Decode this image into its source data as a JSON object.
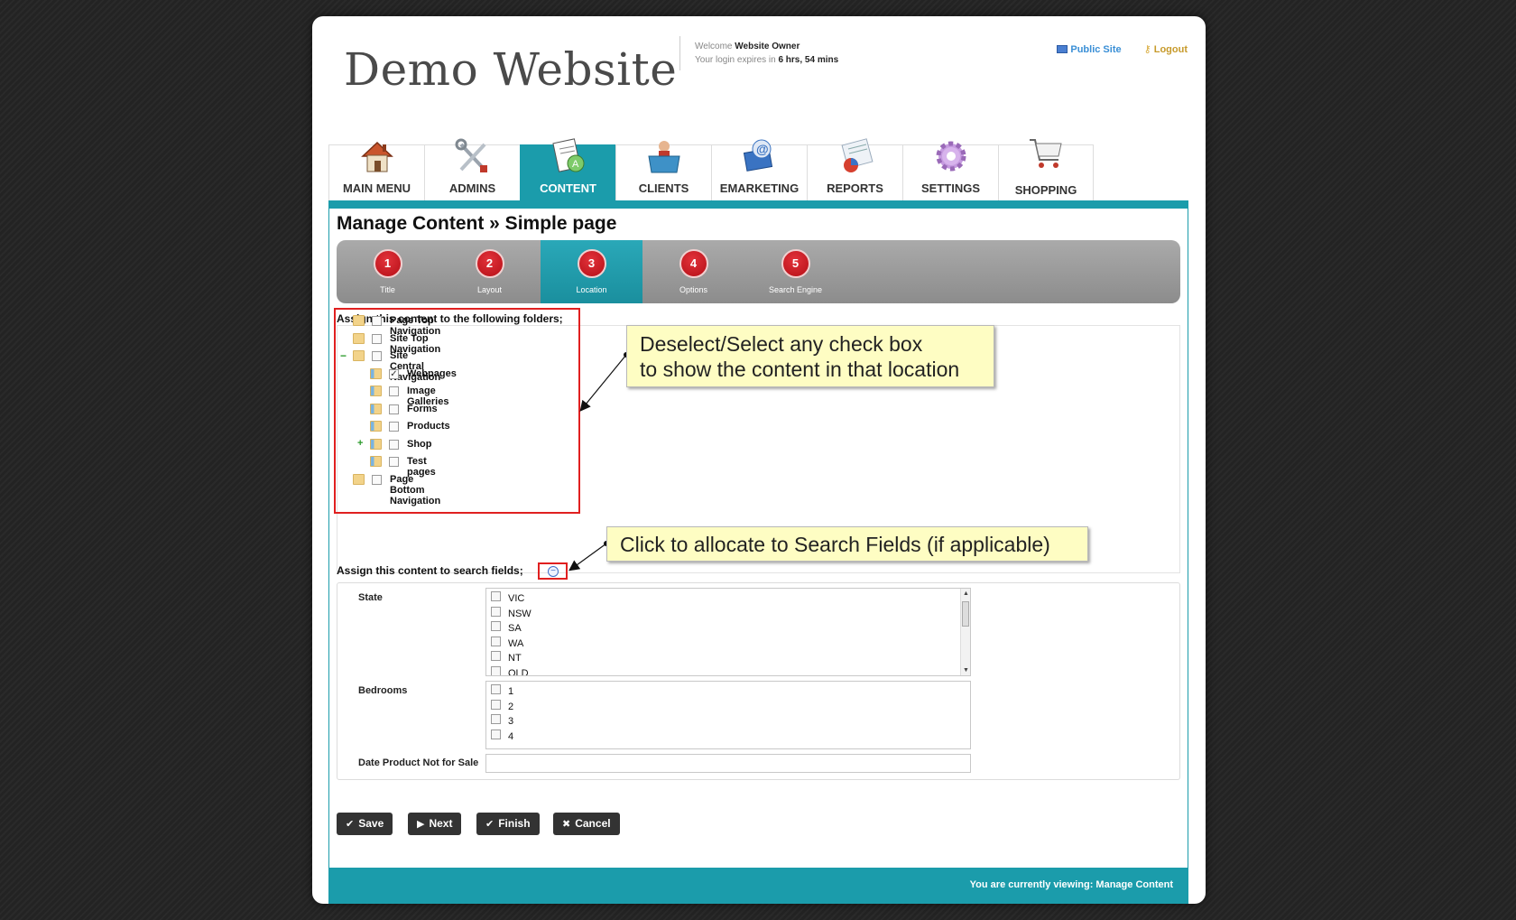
{
  "header": {
    "logo": "Demo Website",
    "welcome_prefix": "Welcome",
    "user": "Website Owner",
    "expiry_prefix": "Your login expires in",
    "expiry_time": "6 hrs, 54 mins",
    "public_site": "Public Site",
    "logout": "Logout"
  },
  "nav": {
    "tabs": [
      {
        "label": "MAIN MENU",
        "icon": "house-icon"
      },
      {
        "label": "ADMINS",
        "icon": "tools-icon"
      },
      {
        "label": "CONTENT",
        "icon": "document-icon",
        "active": true
      },
      {
        "label": "CLIENTS",
        "icon": "person-folder-icon"
      },
      {
        "label": "EMARKETING",
        "icon": "email-icon"
      },
      {
        "label": "REPORTS",
        "icon": "report-icon"
      },
      {
        "label": "SETTINGS",
        "icon": "gear-icon"
      },
      {
        "label": "SHOPPING",
        "icon": "shopping-cart-icon"
      }
    ]
  },
  "page_title": "Manage Content » Simple page",
  "steps": [
    {
      "number": "1",
      "label": "Title"
    },
    {
      "number": "2",
      "label": "Layout"
    },
    {
      "number": "3",
      "label": "Location",
      "active": true
    },
    {
      "number": "4",
      "label": "Options"
    },
    {
      "number": "5",
      "label": "Search Engine"
    }
  ],
  "folders_heading": "Assign this content to the following folders;",
  "folders": [
    {
      "label": "Page Top Navigation",
      "checked": false,
      "level": 0
    },
    {
      "label": "Site Top Navigation",
      "checked": false,
      "level": 0
    },
    {
      "label": "Site Central Navigation",
      "checked": false,
      "level": 0,
      "expander": "−"
    },
    {
      "label": "Webpages",
      "checked": true,
      "level": 1
    },
    {
      "label": "Image Galleries",
      "checked": false,
      "level": 1
    },
    {
      "label": "Forms",
      "checked": false,
      "level": 1
    },
    {
      "label": "Products",
      "checked": false,
      "level": 1
    },
    {
      "label": "Shop",
      "checked": false,
      "level": 1,
      "expander": "+"
    },
    {
      "label": "Test pages",
      "checked": false,
      "level": 1
    },
    {
      "label": "Page Bottom Navigation",
      "checked": false,
      "level": 0
    }
  ],
  "callouts": {
    "checkbox_line1": "Deselect/Select any check box",
    "checkbox_line2": "to show the content in that location",
    "search": "Click to allocate to Search Fields (if applicable)"
  },
  "search_heading": "Assign this content to search fields;",
  "search_fields": {
    "state_label": "State",
    "state_options": [
      "VIC",
      "NSW",
      "SA",
      "WA",
      "NT",
      "QLD"
    ],
    "bedrooms_label": "Bedrooms",
    "bedroom_options": [
      "1",
      "2",
      "3",
      "4"
    ],
    "date_label": "Date Product Not for Sale",
    "date_value": ""
  },
  "buttons": {
    "save": "Save",
    "next": "Next",
    "finish": "Finish",
    "cancel": "Cancel"
  },
  "footer": "You are currently viewing: Manage Content"
}
